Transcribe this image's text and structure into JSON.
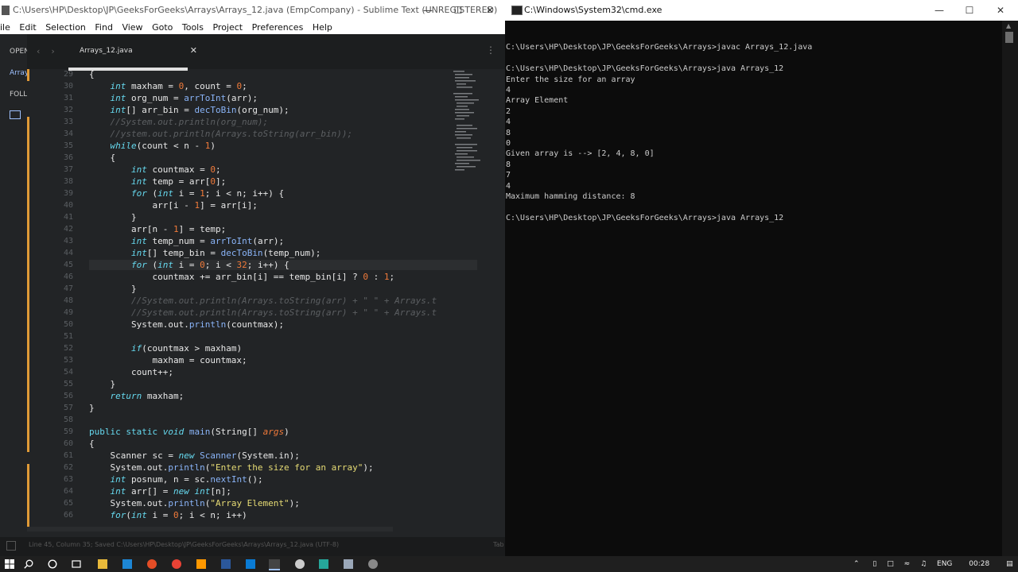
{
  "sublime": {
    "title": "C:\\Users\\HP\\Desktop\\JP\\GeeksForGeeks\\Arrays\\Arrays_12.java (EmpCompany) - Sublime Text (UNREGISTERED)",
    "menu": [
      "ile",
      "Edit",
      "Selection",
      "Find",
      "View",
      "Goto",
      "Tools",
      "Project",
      "Preferences",
      "Help"
    ],
    "sidebar": {
      "open_label": "OPEN",
      "array_label": "Array",
      "folders_label": "FOLL"
    },
    "tab": {
      "label": "Arrays_12.java"
    },
    "status_text": "Line 45, Column 35; Saved C:\\Users\\HP\\Desktop\\JP\\GeeksForGeeks\\Arrays\\Arrays_12.java (UTF-8)",
    "status_tab": "Tab",
    "lines": [
      29,
      30,
      31,
      32,
      33,
      34,
      35,
      36,
      37,
      38,
      39,
      40,
      41,
      42,
      43,
      44,
      45,
      46,
      47,
      48,
      49,
      50,
      51,
      52,
      53,
      54,
      55,
      56,
      57,
      58,
      59,
      60,
      61,
      62,
      63,
      64,
      65,
      66
    ]
  },
  "cmd": {
    "title": "C:\\Windows\\System32\\cmd.exe",
    "output": "\nC:\\Users\\HP\\Desktop\\JP\\GeeksForGeeks\\Arrays>javac Arrays_12.java\n\nC:\\Users\\HP\\Desktop\\JP\\GeeksForGeeks\\Arrays>java Arrays_12\nEnter the size for an array\n4\nArray Element\n2\n4\n8\n0\nGiven array is --> [2, 4, 8, 0]\n8\n7\n4\nMaximum hamming distance: 8\n\nC:\\Users\\HP\\Desktop\\JP\\GeeksForGeeks\\Arrays>java Arrays_12"
  },
  "taskbar": {
    "lang": "ENG",
    "time": "00:28"
  },
  "colors": {
    "keyword": "#66d9ef",
    "function": "#8ab4f8",
    "string": "#e6db74",
    "number": "#f07a3a",
    "comment": "#5c5f62",
    "modified": "#e09a37"
  }
}
